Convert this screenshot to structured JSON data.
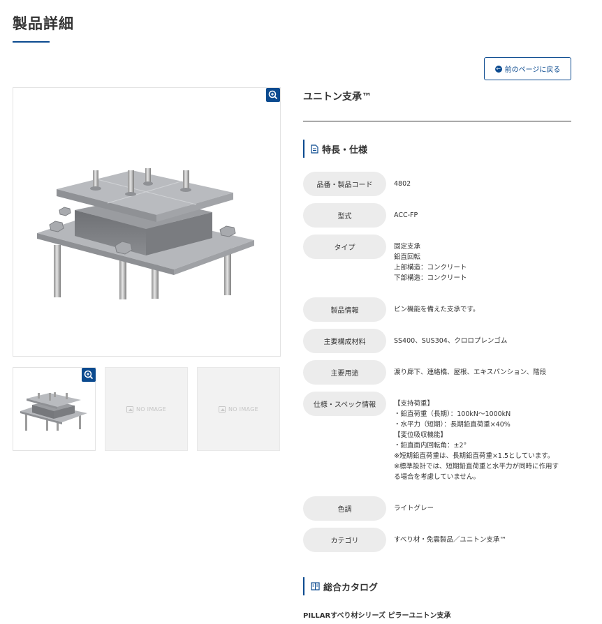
{
  "page": {
    "title": "製品詳細",
    "back_label": "前のページに戻る"
  },
  "gallery": {
    "no_image_label": "NO IMAGE"
  },
  "product": {
    "name": "ユニトン支承™",
    "features_heading": "特長・仕様",
    "specs": [
      {
        "label": "品番・製品コード",
        "value": "4802"
      },
      {
        "label": "型式",
        "value": "ACC-FP"
      },
      {
        "label": "タイプ",
        "value": "固定支承\n鉛直回転\n上部構造：コンクリート\n下部構造：コンクリート"
      },
      {
        "label": "製品情報",
        "value": "ピン機能を備えた支承です。"
      },
      {
        "label": "主要構成材料",
        "value": "SS400、SUS304、クロロプレンゴム"
      },
      {
        "label": "主要用途",
        "value": "渡り廊下、連絡橋、屋根、エキスパンション、階段"
      },
      {
        "label": "仕様・スペック情報",
        "value": "【支持荷重】\n・鉛直荷重（長期）：100kN〜1000kN\n・水平力（短期）：長期鉛直荷重×40%\n【変位吸収機能】\n・鉛直面内回転角：±2°\n※短期鉛直荷重は、長期鉛直荷重×1.5としています。\n※標準設計では、短期鉛直荷重と水平力が同時に作用す\nる場合を考慮していません。"
      },
      {
        "label": "色調",
        "value": "ライトグレー"
      },
      {
        "label": "カテゴリ",
        "value": "すべり材・免震製品／ユニトン支承™"
      }
    ],
    "catalog_heading": "総合カタログ",
    "catalog_item": "PILLARすべり材シリーズ ピラーユニトン支承"
  },
  "colors": {
    "accent": "#0b4a8f",
    "pill_bg": "#ececec"
  }
}
